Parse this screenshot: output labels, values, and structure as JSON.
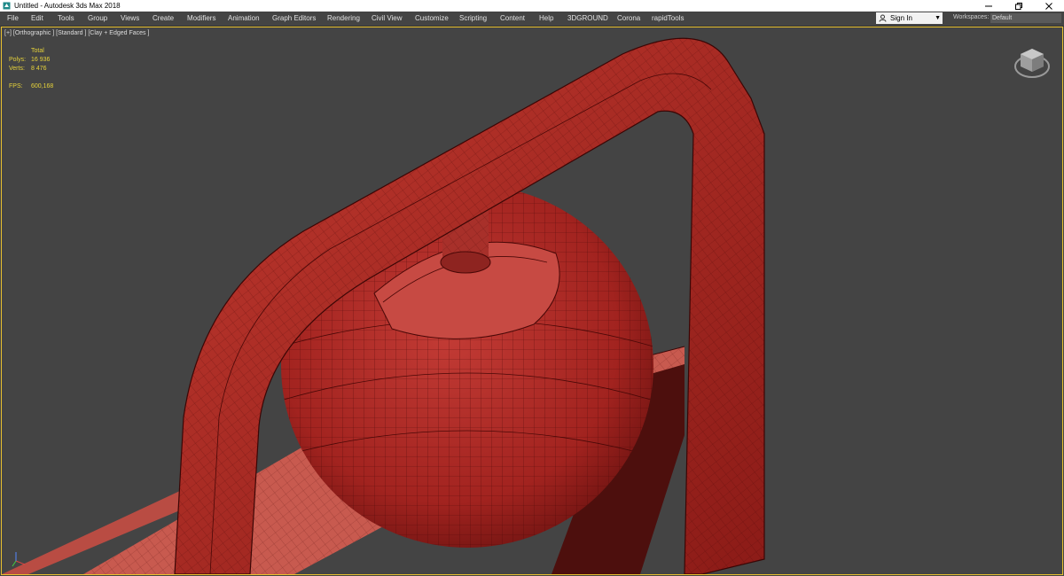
{
  "window": {
    "title": "Untitled - Autodesk 3ds Max 2018",
    "app_icon": "3dsmax-icon"
  },
  "menu": {
    "items": [
      {
        "label": "File"
      },
      {
        "label": "Edit"
      },
      {
        "label": "Tools"
      },
      {
        "label": "Group"
      },
      {
        "label": "Views"
      },
      {
        "label": "Create"
      },
      {
        "label": "Modifiers"
      },
      {
        "label": "Animation"
      },
      {
        "label": "Graph Editors"
      },
      {
        "label": "Rendering"
      },
      {
        "label": "Civil View"
      },
      {
        "label": "Customize"
      },
      {
        "label": "Scripting"
      },
      {
        "label": "Content"
      },
      {
        "label": "Help"
      },
      {
        "label": "3DGROUND"
      },
      {
        "label": "Corona"
      },
      {
        "label": "rapidTools"
      }
    ],
    "sign_in": "Sign In",
    "workspaces_label": "Workspaces:",
    "workspaces_value": "Default"
  },
  "viewport": {
    "label": "[+] [Orthographic ] [Standard ] [Clay + Edged Faces ]",
    "stats": {
      "total_label": "Total",
      "polys_label": "Polys:",
      "polys_value": "16 936",
      "verts_label": "Verts:",
      "verts_value": "8 476",
      "fps_label": "FPS:",
      "fps_value": "600,168"
    }
  },
  "colors": {
    "clay": "#b02a26",
    "clay_dark": "#6e1412",
    "wire": "#4a0807",
    "viewport_bg": "#444444",
    "active_border": "#e8c12f",
    "stats_text": "#e6d23a"
  }
}
